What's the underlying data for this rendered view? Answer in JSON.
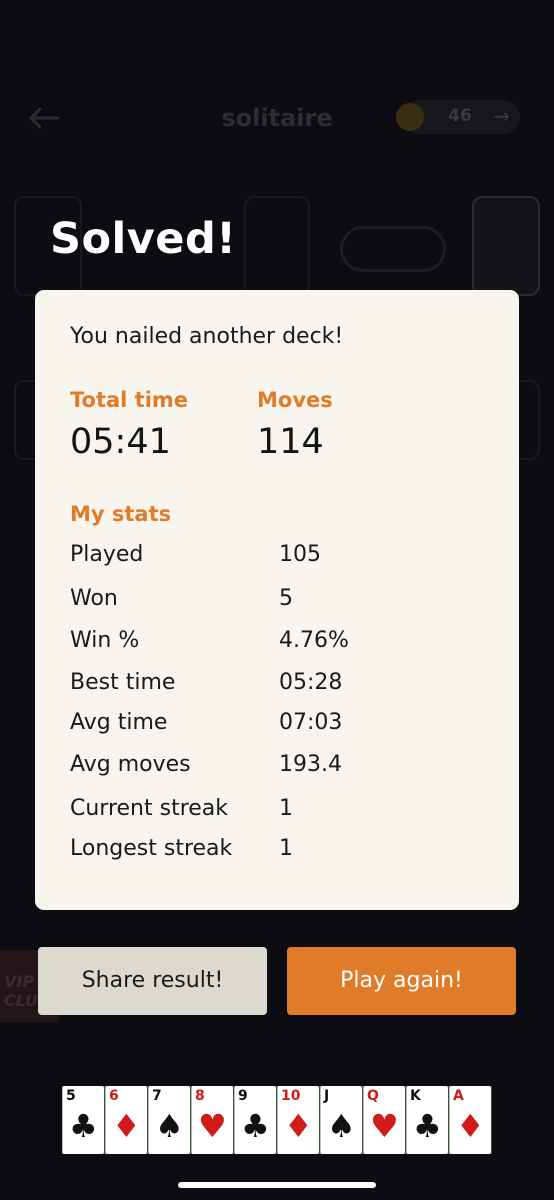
{
  "header": {
    "title": "solitaire",
    "coins": "46"
  },
  "vip": {
    "label": "VIP CLU"
  },
  "overlay": {
    "title": "Solved!",
    "subtitle": "You nailed another deck!",
    "total_time_label": "Total time",
    "total_time_value": "05:41",
    "moves_label": "Moves",
    "moves_value": "114",
    "stats_heading": "My stats",
    "stats": [
      {
        "label": "Played",
        "value": "105"
      },
      {
        "label": "Won",
        "value": "5"
      },
      {
        "label": "Win %",
        "value": "4.76%"
      },
      {
        "label": "Best time",
        "value": "05:28"
      },
      {
        "label": "Avg time",
        "value": "07:03"
      },
      {
        "label": "Avg moves",
        "value": "193.4"
      },
      {
        "label": "Current streak",
        "value": "1"
      },
      {
        "label": "Longest streak",
        "value": "1"
      }
    ],
    "share_button": "Share result!",
    "play_again_button": "Play again!"
  },
  "card_strip": [
    {
      "rank": "5",
      "suit": "♣",
      "color": "black"
    },
    {
      "rank": "6",
      "suit": "♦",
      "color": "red"
    },
    {
      "rank": "7",
      "suit": "♠",
      "color": "black"
    },
    {
      "rank": "8",
      "suit": "♥",
      "color": "red"
    },
    {
      "rank": "9",
      "suit": "♣",
      "color": "black"
    },
    {
      "rank": "10",
      "suit": "♦",
      "color": "red"
    },
    {
      "rank": "J",
      "suit": "♠",
      "color": "black"
    },
    {
      "rank": "Q",
      "suit": "♥",
      "color": "red"
    },
    {
      "rank": "K",
      "suit": "♣",
      "color": "black"
    },
    {
      "rank": "A",
      "suit": "♦",
      "color": "red"
    }
  ],
  "colors": {
    "accent_orange": "#e07b2a",
    "card_bg": "#f8f5ee",
    "share_bg": "#dcd9cf"
  }
}
